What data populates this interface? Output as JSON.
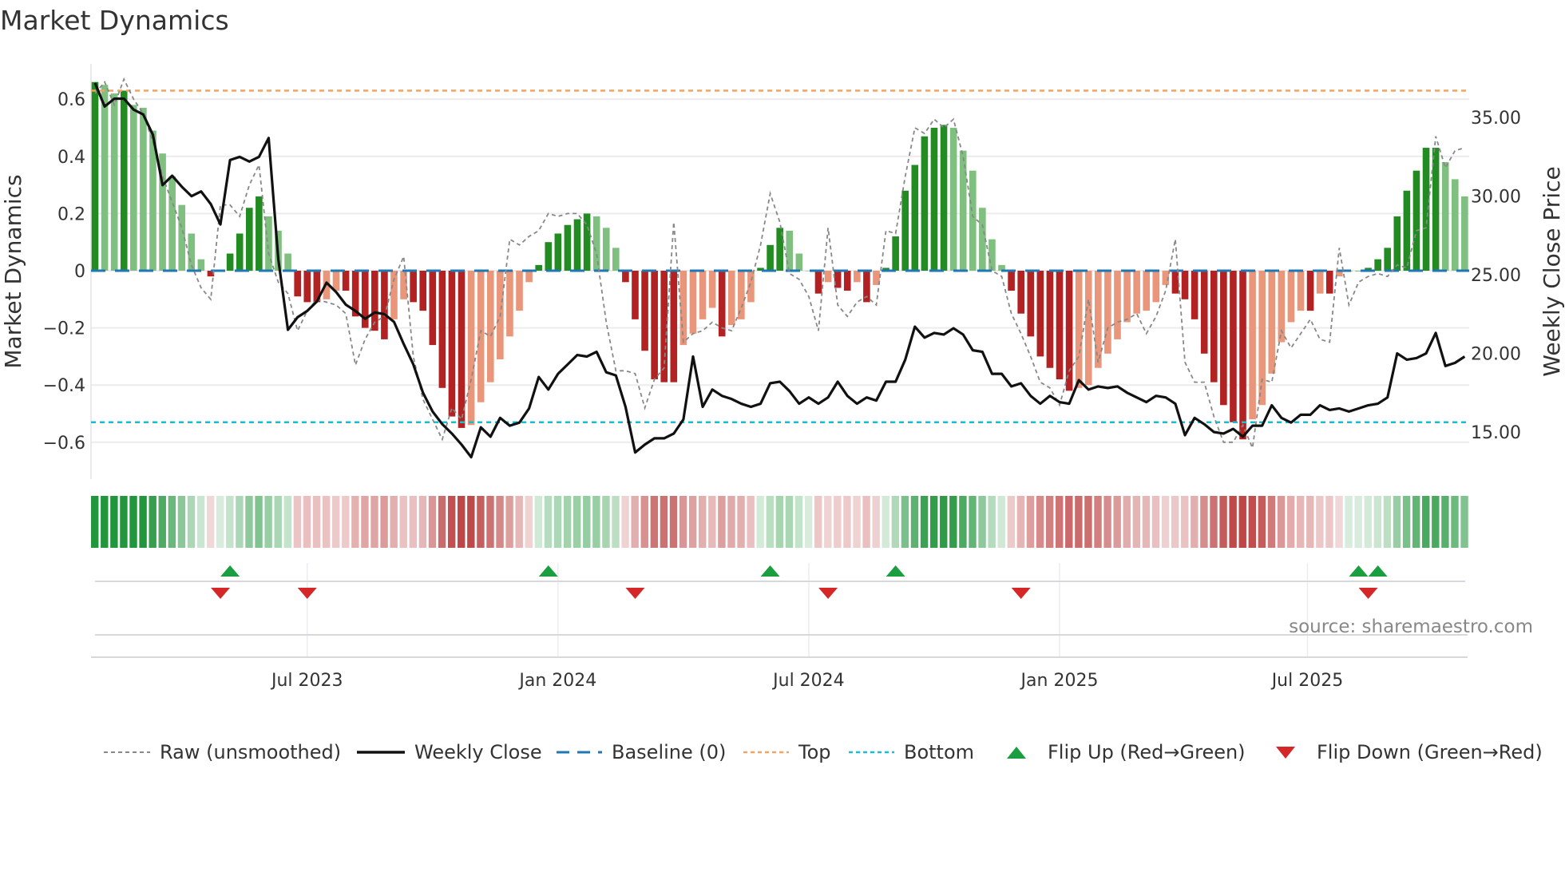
{
  "title": "Market Dynamics",
  "source": "source: sharemaestro.com",
  "colors": {
    "green_dark": "#228b22",
    "green_light": "#7fbf7f",
    "red_dark": "#b22222",
    "red_light": "#e9967a",
    "baseline": "#1f77b4",
    "top": "#f4a460",
    "bottom": "#17becf",
    "raw": "#888888",
    "close": "#111111",
    "flip_up": "#1a9e3f",
    "flip_down": "#d62728"
  },
  "chart_data": {
    "type": "bar",
    "title": "Market Dynamics",
    "ylabel": "Market Dynamics",
    "y2label": "Weekly Close Price",
    "ylim": [
      -0.72,
      0.72
    ],
    "y2lim": [
      12.5,
      38.5
    ],
    "yticks": [
      "0.6",
      "0.4",
      "0.2",
      "0",
      "−0.2",
      "−0.4",
      "−0.6"
    ],
    "ytick_values": [
      0.6,
      0.4,
      0.2,
      0,
      -0.2,
      -0.4,
      -0.6
    ],
    "y2ticks": [
      "35.00",
      "30.00",
      "25.00",
      "20.00",
      "15.00"
    ],
    "y2tick_values": [
      35,
      30,
      25,
      20,
      15
    ],
    "xticks": [
      "Jul 2023",
      "Jan 2024",
      "Jul 2024",
      "Jan 2025",
      "Jul 2025"
    ],
    "xtick_weeks": [
      22,
      48,
      74,
      100,
      125.7
    ],
    "top_level": 0.63,
    "bottom_level": -0.53,
    "baseline": 0,
    "momentum": [
      0.66,
      0.65,
      0.62,
      0.63,
      0.58,
      0.57,
      0.49,
      0.41,
      0.33,
      0.23,
      0.13,
      0.04,
      -0.02,
      0,
      0.06,
      0.13,
      0.22,
      0.26,
      0.19,
      0.14,
      0.06,
      -0.09,
      -0.11,
      -0.11,
      -0.1,
      -0.07,
      -0.07,
      -0.16,
      -0.2,
      -0.21,
      -0.24,
      -0.17,
      -0.1,
      -0.11,
      -0.14,
      -0.26,
      -0.41,
      -0.51,
      -0.55,
      -0.54,
      -0.46,
      -0.39,
      -0.31,
      -0.23,
      -0.14,
      -0.04,
      0.02,
      0.1,
      0.13,
      0.16,
      0.18,
      0.2,
      0.19,
      0.15,
      0.08,
      -0.04,
      -0.17,
      -0.28,
      -0.38,
      -0.39,
      -0.39,
      -0.26,
      -0.22,
      -0.17,
      -0.13,
      -0.23,
      -0.19,
      -0.17,
      -0.11,
      0.01,
      0.09,
      0.15,
      0.14,
      0.06,
      0,
      -0.08,
      -0.04,
      -0.06,
      -0.07,
      -0.04,
      -0.11,
      -0.05,
      0.01,
      0.12,
      0.28,
      0.37,
      0.47,
      0.5,
      0.51,
      0.5,
      0.42,
      0.35,
      0.22,
      0.11,
      0.02,
      -0.07,
      -0.15,
      -0.23,
      -0.3,
      -0.34,
      -0.38,
      -0.42,
      -0.41,
      -0.4,
      -0.34,
      -0.29,
      -0.24,
      -0.18,
      -0.15,
      -0.14,
      -0.11,
      -0.05,
      -0.08,
      -0.1,
      -0.17,
      -0.29,
      -0.39,
      -0.47,
      -0.53,
      -0.59,
      -0.52,
      -0.47,
      -0.36,
      -0.25,
      -0.18,
      -0.14,
      -0.14,
      -0.08,
      -0.08,
      -0.02,
      0,
      0,
      0.01,
      0.04,
      0.08,
      0.19,
      0.28,
      0.35,
      0.43,
      0.43,
      0.38,
      0.32,
      0.26
    ],
    "raw": [
      0.62,
      0.66,
      0.58,
      0.67,
      0.6,
      0.55,
      0.45,
      0.33,
      0.24,
      0.15,
      0.02,
      -0.06,
      -0.1,
      0.23,
      0.23,
      0.19,
      0.3,
      0.37,
      0.06,
      -0.04,
      -0.08,
      -0.21,
      -0.14,
      -0.1,
      -0.11,
      -0.12,
      -0.15,
      -0.33,
      -0.24,
      -0.18,
      -0.16,
      -0.03,
      0.05,
      -0.3,
      -0.45,
      -0.52,
      -0.59,
      -0.48,
      -0.52,
      -0.38,
      -0.21,
      -0.23,
      -0.16,
      0.11,
      0.09,
      0.12,
      0.14,
      0.2,
      0.19,
      0.2,
      0.2,
      0.16,
      0.06,
      -0.18,
      -0.35,
      -0.35,
      -0.36,
      -0.48,
      -0.38,
      -0.34,
      0.17,
      -0.25,
      -0.22,
      -0.21,
      -0.18,
      -0.2,
      -0.21,
      -0.13,
      -0.04,
      0.09,
      0.27,
      0.17,
      -0.01,
      -0.03,
      -0.09,
      -0.21,
      0.15,
      -0.12,
      -0.16,
      -0.11,
      -0.09,
      -0.12,
      0.14,
      0.13,
      0.33,
      0.5,
      0.48,
      0.53,
      0.5,
      0.53,
      0.4,
      0.19,
      0.16,
      0.0,
      -0.02,
      -0.15,
      -0.22,
      -0.3,
      -0.39,
      -0.41,
      -0.47,
      -0.35,
      -0.3,
      -0.1,
      -0.32,
      -0.2,
      -0.18,
      -0.17,
      -0.15,
      -0.22,
      -0.16,
      -0.07,
      0.11,
      -0.32,
      -0.39,
      -0.39,
      -0.51,
      -0.6,
      -0.6,
      -0.54,
      -0.62,
      -0.38,
      -0.39,
      -0.21,
      -0.27,
      -0.22,
      -0.17,
      -0.24,
      -0.25,
      0.08,
      -0.12,
      -0.04,
      -0.02,
      -0.01,
      -0.02,
      0.02,
      0.01,
      0.14,
      0.15,
      0.47,
      0.36,
      0.42,
      0.43,
      0.51,
      0.28,
      0.28,
      0.31
    ],
    "close": [
      37.2,
      35.7,
      36.2,
      36.2,
      35.5,
      35.2,
      33.9,
      30.7,
      31.3,
      30.6,
      30.0,
      30.3,
      29.5,
      28.2,
      32.3,
      32.5,
      32.2,
      32.5,
      33.7,
      26.0,
      21.5,
      22.3,
      22.7,
      23.3,
      24.5,
      23.9,
      23.1,
      22.7,
      22.2,
      22.6,
      22.5,
      22.0,
      20.6,
      19.3,
      17.5,
      16.3,
      15.5,
      14.9,
      14.2,
      13.4,
      15.3,
      14.7,
      15.9,
      15.4,
      15.6,
      16.5,
      18.5,
      17.7,
      18.7,
      19.3,
      19.9,
      19.8,
      20.1,
      18.8,
      18.6,
      16.6,
      13.7,
      14.2,
      14.6,
      14.6,
      14.9,
      15.8,
      19.8,
      16.6,
      17.7,
      17.3,
      17.1,
      16.8,
      16.6,
      16.8,
      18.1,
      18.2,
      17.6,
      16.8,
      17.2,
      16.8,
      17.2,
      18.2,
      17.3,
      16.8,
      17.2,
      17.0,
      18.2,
      18.2,
      19.6,
      21.7,
      21.0,
      21.3,
      21.2,
      21.6,
      21.2,
      20.2,
      20.1,
      18.7,
      18.7,
      17.9,
      18.1,
      17.3,
      16.8,
      17.3,
      16.9,
      16.8,
      18.3,
      17.7,
      17.9,
      17.8,
      17.9,
      17.5,
      17.2,
      16.9,
      17.3,
      17.2,
      16.8,
      14.8,
      15.9,
      15.5,
      15.0,
      14.9,
      15.2,
      14.7,
      15.4,
      15.4,
      16.7,
      15.9,
      15.6,
      16.1,
      16.1,
      16.7,
      16.4,
      16.5,
      16.3,
      16.5,
      16.7,
      16.8,
      17.2,
      20.0,
      19.6,
      19.7,
      20.0,
      21.3,
      19.2,
      19.4,
      19.8
    ],
    "flip_up_weeks": [
      14,
      47,
      70,
      83,
      131,
      133
    ],
    "flip_down_weeks": [
      13,
      22,
      56,
      76,
      96,
      132
    ],
    "legend": [
      "Raw (unsmoothed)",
      "Weekly Close",
      "Baseline (0)",
      "Top",
      "Bottom",
      "Flip Up (Red→Green)",
      "Flip Down (Green→Red)"
    ],
    "legend_placement": "bottom"
  }
}
